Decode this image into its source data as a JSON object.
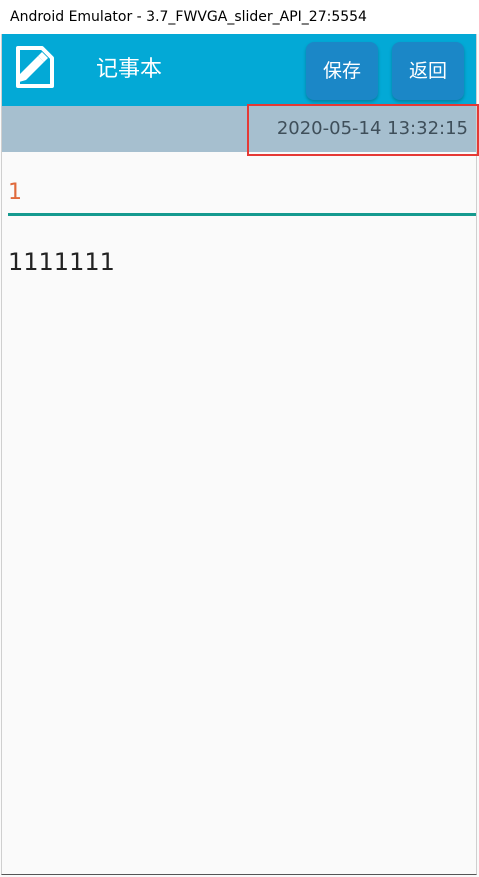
{
  "window": {
    "title": "Android Emulator - 3.7_FWVGA_slider_API_27:5554"
  },
  "appbar": {
    "title": "记事本",
    "icon": "note-edit-icon",
    "save_label": "保存",
    "back_label": "返回",
    "background_color": "#03a9d6",
    "button_color": "#1b87c7"
  },
  "datebar": {
    "timestamp": "2020-05-14 13:32:15",
    "background_color": "#a6bfcf",
    "highlight_color": "#e53935"
  },
  "editor": {
    "title_value": "1",
    "content_value": "1111111",
    "title_color": "#e06a3c",
    "underline_color": "#159a8f"
  }
}
